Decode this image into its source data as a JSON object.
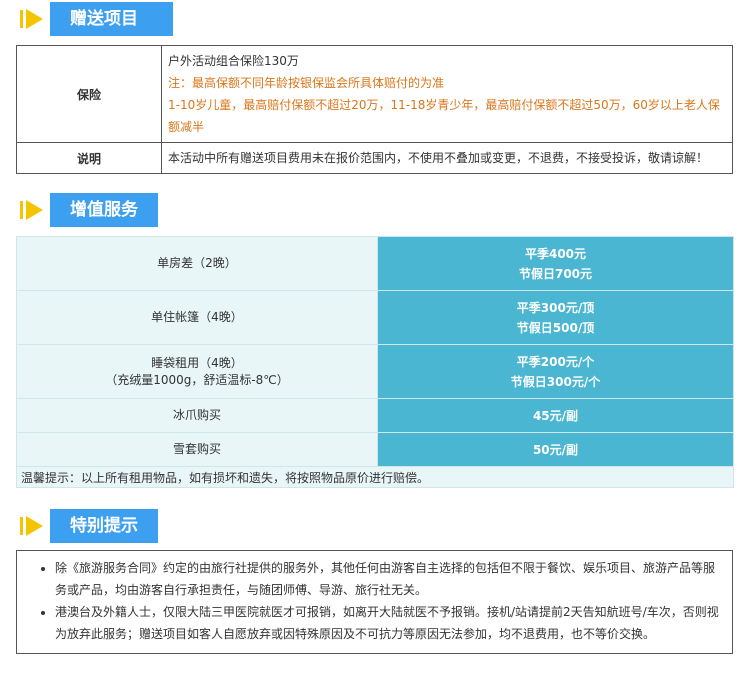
{
  "sections": {
    "gifts_title": "赠送项目",
    "value_title": "增值服务",
    "special_title": "特别提示"
  },
  "gifts": {
    "insurance_label": "保险",
    "insurance_line1": "户外活动组合保险130万",
    "insurance_line2": "注：最高保额不同年龄按银保监会所具体赔付的为准",
    "insurance_line3": "1-10岁儿童，最高赔付保额不超过20万，11-18岁青少年，最高赔付保额不超过50万，60岁以上老人保额减半",
    "note_label": "说明",
    "note_text": "本活动中所有赠送项目费用未在报价范围内，不使用不叠加或变更，不退费，不接受投诉，敬请谅解！"
  },
  "services": [
    {
      "name": "单房差（2晚）",
      "sub": "",
      "price1": "平季400元",
      "price2": "节假日700元"
    },
    {
      "name": "单住帐篷（4晚）",
      "sub": "",
      "price1": "平季300元/顶",
      "price2": "节假日500/顶"
    },
    {
      "name": "睡袋租用（4晚）",
      "sub": "（充绒量1000g，舒适温标-8℃）",
      "price1": "平季200元/个",
      "price2": "节假日300元/个"
    },
    {
      "name": "冰爪购买",
      "sub": "",
      "price1": "45元/副",
      "price2": ""
    },
    {
      "name": "雪套购买",
      "sub": "",
      "price1": "50元/副",
      "price2": ""
    }
  ],
  "services_note": "温馨提示：以上所有租用物品，如有损坏和遗失，将按照物品原价进行赔偿。",
  "tips": [
    "除《旅游服务合同》约定的由旅行社提供的服务外，其他任何由游客自主选择的包括但不限于餐饮、娱乐项目、旅游产品等服务或产品，均由游客自行承担责任，与随团师傅、导游、旅行社无关。",
    "港澳台及外籍人士，仅限大陆三甲医院就医才可报销，如离开大陆就医不予报销。接机/站请提前2天告知航班号/车次，否则视为放弃此服务；赠送项目如客人自愿放弃或因特殊原因及不可抗力等原因无法参加，均不退费用，也不等价交换。"
  ],
  "colors": {
    "header_blue": "#3d9ff0",
    "arrow_yellow": "#f5c400",
    "price_teal": "#4ab6d1",
    "row_bg": "#e8f6f8",
    "orange_text": "#d9761a"
  },
  "icons": {
    "section_marker": "play-arrow-icon"
  }
}
